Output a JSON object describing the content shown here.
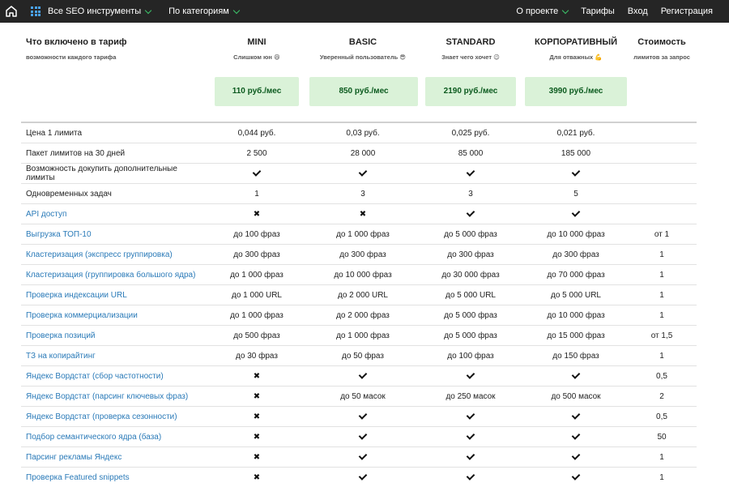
{
  "nav": {
    "all_tools": "Все SEO инструменты",
    "by_category": "По категориям",
    "about": "О проекте",
    "tariffs": "Тарифы",
    "login": "Вход",
    "register": "Регистрация"
  },
  "header": {
    "title": "Что включено в тариф",
    "subtitle": "возможности каждого тарифа",
    "cost_title": "Стоимость",
    "cost_subtitle": "лимитов за запрос"
  },
  "plans": [
    {
      "name": "MINI",
      "subtitle": "Слишком юн 😄",
      "price": "110 руб./мес"
    },
    {
      "name": "BASIC",
      "subtitle": "Уверенный пользователь 😎",
      "price": "850 руб./мес"
    },
    {
      "name": "STANDARD",
      "subtitle": "Знает чего хочет 😉",
      "price": "2190 руб./мес"
    },
    {
      "name": "КОРПОРАТИВНЫЙ",
      "subtitle": "Для отважных 💪",
      "price": "3990 руб./мес"
    }
  ],
  "rows": [
    {
      "feature": "Цена 1 лимита",
      "link": false,
      "values": [
        "0,044 руб.",
        "0,03 руб.",
        "0,025 руб.",
        "0,021 руб."
      ],
      "cost": ""
    },
    {
      "feature": "Пакет лимитов на 30 дней",
      "link": false,
      "values": [
        "2 500",
        "28 000",
        "85 000",
        "185 000"
      ],
      "cost": ""
    },
    {
      "feature": "Возможность докупить дополнительные лимиты",
      "link": false,
      "values": [
        "check",
        "check",
        "check",
        "check"
      ],
      "cost": ""
    },
    {
      "feature": "Одновременных задач",
      "link": false,
      "values": [
        "1",
        "3",
        "3",
        "5"
      ],
      "cost": ""
    },
    {
      "feature": "API доступ",
      "link": true,
      "values": [
        "cross",
        "cross",
        "check",
        "check"
      ],
      "cost": ""
    },
    {
      "feature": "Выгрузка ТОП-10",
      "link": true,
      "values": [
        "до 100 фраз",
        "до 1 000 фраз",
        "до 5 000 фраз",
        "до 10 000 фраз"
      ],
      "cost": "от 1"
    },
    {
      "feature": "Кластеризация (экспресс группировка)",
      "link": true,
      "values": [
        "до 300 фраз",
        "до 300 фраз",
        "до 300 фраз",
        "до 300 фраз"
      ],
      "cost": "1"
    },
    {
      "feature": "Кластеризация (группировка большого ядра)",
      "link": true,
      "values": [
        "до 1 000 фраз",
        "до 10 000 фраз",
        "до 30 000 фраз",
        "до 70 000 фраз"
      ],
      "cost": "1"
    },
    {
      "feature": "Проверка индексации URL",
      "link": true,
      "values": [
        "до 1 000 URL",
        "до 2 000 URL",
        "до 5 000 URL",
        "до 5 000 URL"
      ],
      "cost": "1"
    },
    {
      "feature": "Проверка коммерциализации",
      "link": true,
      "values": [
        "до 1 000 фраз",
        "до 2 000 фраз",
        "до 5 000 фраз",
        "до 10 000 фраз"
      ],
      "cost": "1"
    },
    {
      "feature": "Проверка позиций",
      "link": true,
      "values": [
        "до 500 фраз",
        "до 1 000 фраз",
        "до 5 000 фраз",
        "до 15 000 фраз"
      ],
      "cost": "от 1,5"
    },
    {
      "feature": "ТЗ на копирайтинг",
      "link": true,
      "values": [
        "до 30 фраз",
        "до 50 фраз",
        "до 100 фраз",
        "до 150 фраз"
      ],
      "cost": "1"
    },
    {
      "feature": "Яндекс Вордстат (сбор частотности)",
      "link": true,
      "values": [
        "cross",
        "check",
        "check",
        "check"
      ],
      "cost": "0,5"
    },
    {
      "feature": "Яндекс Вордстат (парсинг ключевых фраз)",
      "link": true,
      "values": [
        "cross",
        "до 50 масок",
        "до 250 масок",
        "до 500 масок"
      ],
      "cost": "2"
    },
    {
      "feature": "Яндекс Вордстат (проверка сезонности)",
      "link": true,
      "values": [
        "cross",
        "check",
        "check",
        "check"
      ],
      "cost": "0,5"
    },
    {
      "feature": "Подбор семантического ядра (база)",
      "link": true,
      "values": [
        "cross",
        "check",
        "check",
        "check"
      ],
      "cost": "50"
    },
    {
      "feature": "Парсинг рекламы Яндекс",
      "link": true,
      "values": [
        "cross",
        "check",
        "check",
        "check"
      ],
      "cost": "1"
    },
    {
      "feature": "Проверка Featured snippets",
      "link": true,
      "values": [
        "cross",
        "check",
        "check",
        "check"
      ],
      "cost": "1"
    }
  ]
}
